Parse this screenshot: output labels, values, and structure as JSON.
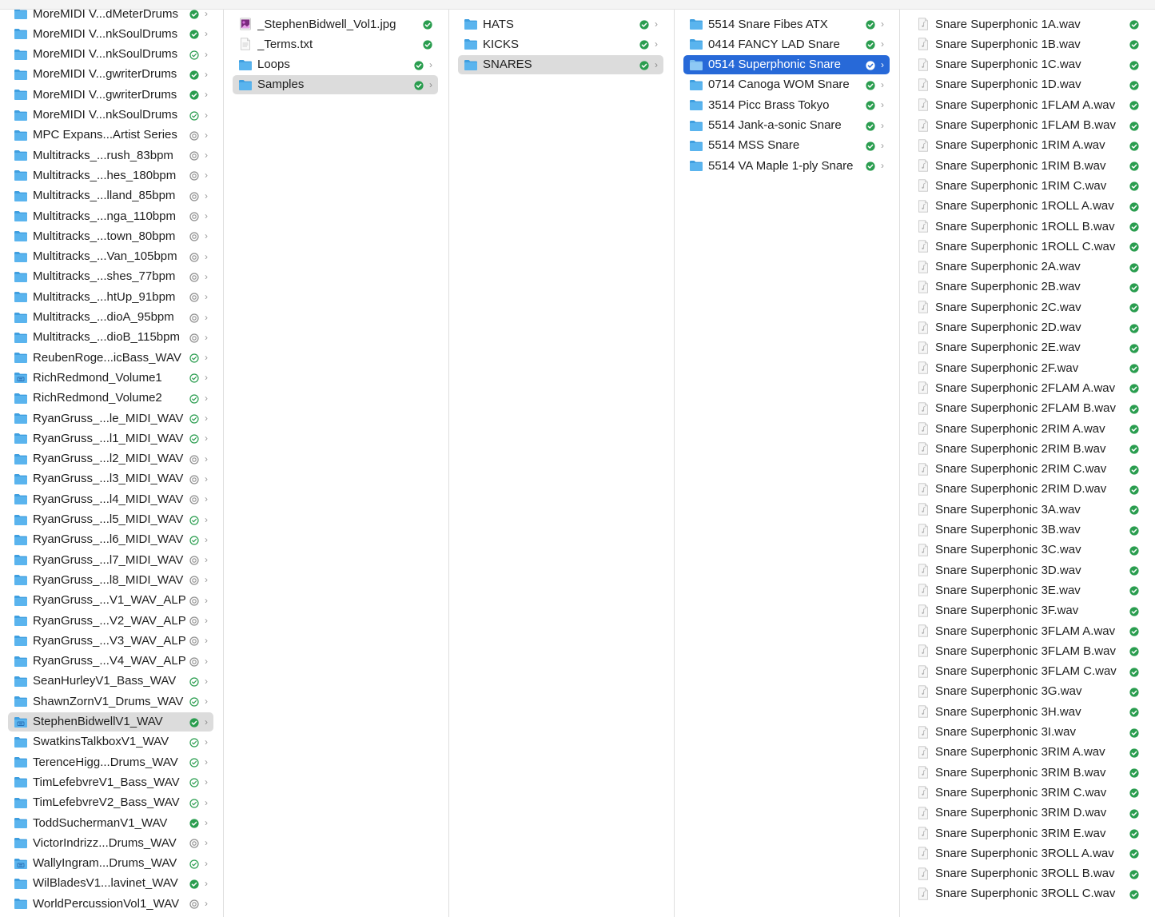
{
  "columns": [
    {
      "name": "library",
      "items": [
        {
          "label": "MoreMIDI V...dMeterDrums",
          "icon": "folder-icon",
          "status": "synced"
        },
        {
          "label": "MoreMIDI V...nkSoulDrums",
          "icon": "folder-icon",
          "status": "synced"
        },
        {
          "label": "MoreMIDI V...nkSoulDrums",
          "icon": "folder-icon",
          "status": "available"
        },
        {
          "label": "MoreMIDI V...gwriterDrums",
          "icon": "folder-icon",
          "status": "synced"
        },
        {
          "label": "MoreMIDI V...gwriterDrums",
          "icon": "folder-icon",
          "status": "synced"
        },
        {
          "label": "MoreMIDI V...nkSoulDrums",
          "icon": "folder-icon",
          "status": "available"
        },
        {
          "label": "MPC Expans...Artist Series",
          "icon": "folder-icon",
          "status": "cloud"
        },
        {
          "label": "Multitracks_...rush_83bpm",
          "icon": "folder-icon",
          "status": "cloud"
        },
        {
          "label": "Multitracks_...hes_180bpm",
          "icon": "folder-icon",
          "status": "cloud"
        },
        {
          "label": "Multitracks_...lland_85bpm",
          "icon": "folder-icon",
          "status": "cloud"
        },
        {
          "label": "Multitracks_...nga_110bpm",
          "icon": "folder-icon",
          "status": "cloud"
        },
        {
          "label": "Multitracks_...town_80bpm",
          "icon": "folder-icon",
          "status": "cloud"
        },
        {
          "label": "Multitracks_...Van_105bpm",
          "icon": "folder-icon",
          "status": "cloud"
        },
        {
          "label": "Multitracks_...shes_77bpm",
          "icon": "folder-icon",
          "status": "cloud"
        },
        {
          "label": "Multitracks_...htUp_91bpm",
          "icon": "folder-icon",
          "status": "cloud"
        },
        {
          "label": "Multitracks_...dioA_95bpm",
          "icon": "folder-icon",
          "status": "cloud"
        },
        {
          "label": "Multitracks_...dioB_115bpm",
          "icon": "folder-icon",
          "status": "cloud"
        },
        {
          "label": "ReubenRoge...icBass_WAV",
          "icon": "folder-icon",
          "status": "available"
        },
        {
          "label": "RichRedmond_Volume1",
          "icon": "app-folder-icon",
          "status": "available"
        },
        {
          "label": "RichRedmond_Volume2",
          "icon": "folder-icon",
          "status": "available"
        },
        {
          "label": "RyanGruss_...le_MIDI_WAV",
          "icon": "folder-icon",
          "status": "available"
        },
        {
          "label": "RyanGruss_...l1_MIDI_WAV",
          "icon": "folder-icon",
          "status": "available"
        },
        {
          "label": "RyanGruss_...l2_MIDI_WAV",
          "icon": "folder-icon",
          "status": "cloud"
        },
        {
          "label": "RyanGruss_...l3_MIDI_WAV",
          "icon": "folder-icon",
          "status": "cloud"
        },
        {
          "label": "RyanGruss_...l4_MIDI_WAV",
          "icon": "folder-icon",
          "status": "cloud"
        },
        {
          "label": "RyanGruss_...l5_MIDI_WAV",
          "icon": "folder-icon",
          "status": "available"
        },
        {
          "label": "RyanGruss_...l6_MIDI_WAV",
          "icon": "folder-icon",
          "status": "available"
        },
        {
          "label": "RyanGruss_...l7_MIDI_WAV",
          "icon": "folder-icon",
          "status": "cloud"
        },
        {
          "label": "RyanGruss_...l8_MIDI_WAV",
          "icon": "folder-icon",
          "status": "cloud"
        },
        {
          "label": "RyanGruss_...V1_WAV_ALP",
          "icon": "folder-icon",
          "status": "cloud"
        },
        {
          "label": "RyanGruss_...V2_WAV_ALP",
          "icon": "folder-icon",
          "status": "cloud"
        },
        {
          "label": "RyanGruss_...V3_WAV_ALP",
          "icon": "folder-icon",
          "status": "cloud"
        },
        {
          "label": "RyanGruss_...V4_WAV_ALP",
          "icon": "folder-icon",
          "status": "cloud"
        },
        {
          "label": "SeanHurleyV1_Bass_WAV",
          "icon": "folder-icon",
          "status": "available"
        },
        {
          "label": "ShawnZornV1_Drums_WAV",
          "icon": "folder-icon",
          "status": "available"
        },
        {
          "label": "StephenBidwellV1_WAV",
          "icon": "app-folder-icon",
          "status": "synced",
          "selected": "gray",
          "chevron": true
        },
        {
          "label": "SwatkinsTalkboxV1_WAV",
          "icon": "folder-icon",
          "status": "available"
        },
        {
          "label": "TerenceHigg...Drums_WAV",
          "icon": "folder-icon",
          "status": "available"
        },
        {
          "label": "TimLefebvreV1_Bass_WAV",
          "icon": "folder-icon",
          "status": "available"
        },
        {
          "label": "TimLefebvreV2_Bass_WAV",
          "icon": "folder-icon",
          "status": "available"
        },
        {
          "label": "ToddSuchermanV1_WAV",
          "icon": "folder-icon",
          "status": "synced"
        },
        {
          "label": "VictorIndrizz...Drums_WAV",
          "icon": "folder-icon",
          "status": "cloud"
        },
        {
          "label": "WallyIngram...Drums_WAV",
          "icon": "app-folder-icon",
          "status": "available"
        },
        {
          "label": "WilBladesV1...lavinet_WAV",
          "icon": "folder-icon",
          "status": "synced"
        },
        {
          "label": "WorldPercussionVol1_WAV",
          "icon": "folder-icon",
          "status": "cloud"
        }
      ]
    },
    {
      "name": "stephen-bidwell",
      "items": [
        {
          "label": "_StephenBidwell_Vol1.jpg",
          "icon": "image-file-icon",
          "status": "synced",
          "chevron": false
        },
        {
          "label": "_Terms.txt",
          "icon": "text-file-icon",
          "status": "synced",
          "chevron": false
        },
        {
          "label": "Loops",
          "icon": "folder-icon",
          "status": "synced"
        },
        {
          "label": "Samples",
          "icon": "folder-icon",
          "status": "synced",
          "selected": "gray"
        }
      ]
    },
    {
      "name": "samples",
      "items": [
        {
          "label": "HATS",
          "icon": "folder-icon",
          "status": "synced"
        },
        {
          "label": "KICKS",
          "icon": "folder-icon",
          "status": "synced"
        },
        {
          "label": "SNARES",
          "icon": "folder-icon",
          "status": "synced",
          "selected": "gray"
        }
      ]
    },
    {
      "name": "snares",
      "items": [
        {
          "label": " 5514 Snare Fibes ATX",
          "icon": "folder-icon",
          "status": "synced"
        },
        {
          "label": "0414 FANCY LAD Snare",
          "icon": "folder-icon",
          "status": "synced"
        },
        {
          "label": "0514 Superphonic Snare",
          "icon": "folder-icon",
          "status": "synced",
          "selected": "blue"
        },
        {
          "label": "0714 Canoga WOM Snare",
          "icon": "folder-icon",
          "status": "synced"
        },
        {
          "label": "3514 Picc Brass Tokyo",
          "icon": "folder-icon",
          "status": "synced"
        },
        {
          "label": "5514 Jank-a-sonic Snare",
          "icon": "folder-icon",
          "status": "synced"
        },
        {
          "label": "5514 MSS Snare",
          "icon": "folder-icon",
          "status": "synced"
        },
        {
          "label": "5514 VA Maple 1-ply Snare",
          "icon": "folder-icon",
          "status": "synced"
        }
      ]
    },
    {
      "name": "superphonic-snare",
      "items": [
        {
          "label": "Snare Superphonic 1A.wav",
          "icon": "audio-file-icon",
          "status": "synced",
          "chevron": false
        },
        {
          "label": "Snare Superphonic 1B.wav",
          "icon": "audio-file-icon",
          "status": "synced",
          "chevron": false
        },
        {
          "label": "Snare Superphonic 1C.wav",
          "icon": "audio-file-icon",
          "status": "synced",
          "chevron": false
        },
        {
          "label": "Snare Superphonic 1D.wav",
          "icon": "audio-file-icon",
          "status": "synced",
          "chevron": false
        },
        {
          "label": "Snare Superphonic 1FLAM A.wav",
          "icon": "audio-file-icon",
          "status": "synced",
          "chevron": false
        },
        {
          "label": "Snare Superphonic 1FLAM B.wav",
          "icon": "audio-file-icon",
          "status": "synced",
          "chevron": false
        },
        {
          "label": "Snare Superphonic 1RIM A.wav",
          "icon": "audio-file-icon",
          "status": "synced",
          "chevron": false
        },
        {
          "label": "Snare Superphonic 1RIM B.wav",
          "icon": "audio-file-icon",
          "status": "synced",
          "chevron": false
        },
        {
          "label": "Snare Superphonic 1RIM C.wav",
          "icon": "audio-file-icon",
          "status": "synced",
          "chevron": false
        },
        {
          "label": "Snare Superphonic 1ROLL A.wav",
          "icon": "audio-file-icon",
          "status": "synced",
          "chevron": false
        },
        {
          "label": "Snare Superphonic 1ROLL B.wav",
          "icon": "audio-file-icon",
          "status": "synced",
          "chevron": false
        },
        {
          "label": "Snare Superphonic 1ROLL C.wav",
          "icon": "audio-file-icon",
          "status": "synced",
          "chevron": false
        },
        {
          "label": "Snare Superphonic 2A.wav",
          "icon": "audio-file-icon",
          "status": "synced",
          "chevron": false
        },
        {
          "label": "Snare Superphonic 2B.wav",
          "icon": "audio-file-icon",
          "status": "synced",
          "chevron": false
        },
        {
          "label": "Snare Superphonic 2C.wav",
          "icon": "audio-file-icon",
          "status": "synced",
          "chevron": false
        },
        {
          "label": "Snare Superphonic 2D.wav",
          "icon": "audio-file-icon",
          "status": "synced",
          "chevron": false
        },
        {
          "label": "Snare Superphonic 2E.wav",
          "icon": "audio-file-icon",
          "status": "synced",
          "chevron": false
        },
        {
          "label": "Snare Superphonic 2F.wav",
          "icon": "audio-file-icon",
          "status": "synced",
          "chevron": false
        },
        {
          "label": "Snare Superphonic 2FLAM A.wav",
          "icon": "audio-file-icon",
          "status": "synced",
          "chevron": false
        },
        {
          "label": "Snare Superphonic 2FLAM B.wav",
          "icon": "audio-file-icon",
          "status": "synced",
          "chevron": false
        },
        {
          "label": "Snare Superphonic 2RIM A.wav",
          "icon": "audio-file-icon",
          "status": "synced",
          "chevron": false
        },
        {
          "label": "Snare Superphonic 2RIM B.wav",
          "icon": "audio-file-icon",
          "status": "synced",
          "chevron": false
        },
        {
          "label": "Snare Superphonic 2RIM C.wav",
          "icon": "audio-file-icon",
          "status": "synced",
          "chevron": false
        },
        {
          "label": "Snare Superphonic 2RIM D.wav",
          "icon": "audio-file-icon",
          "status": "synced",
          "chevron": false
        },
        {
          "label": "Snare Superphonic 3A.wav",
          "icon": "audio-file-icon",
          "status": "synced",
          "chevron": false
        },
        {
          "label": "Snare Superphonic 3B.wav",
          "icon": "audio-file-icon",
          "status": "synced",
          "chevron": false
        },
        {
          "label": "Snare Superphonic 3C.wav",
          "icon": "audio-file-icon",
          "status": "synced",
          "chevron": false
        },
        {
          "label": "Snare Superphonic 3D.wav",
          "icon": "audio-file-icon",
          "status": "synced",
          "chevron": false
        },
        {
          "label": "Snare Superphonic 3E.wav",
          "icon": "audio-file-icon",
          "status": "synced",
          "chevron": false
        },
        {
          "label": "Snare Superphonic 3F.wav",
          "icon": "audio-file-icon",
          "status": "synced",
          "chevron": false
        },
        {
          "label": "Snare Superphonic 3FLAM A.wav",
          "icon": "audio-file-icon",
          "status": "synced",
          "chevron": false
        },
        {
          "label": "Snare Superphonic 3FLAM B.wav",
          "icon": "audio-file-icon",
          "status": "synced",
          "chevron": false
        },
        {
          "label": "Snare Superphonic 3FLAM C.wav",
          "icon": "audio-file-icon",
          "status": "synced",
          "chevron": false
        },
        {
          "label": "Snare Superphonic 3G.wav",
          "icon": "audio-file-icon",
          "status": "synced",
          "chevron": false
        },
        {
          "label": "Snare Superphonic 3H.wav",
          "icon": "audio-file-icon",
          "status": "synced",
          "chevron": false
        },
        {
          "label": "Snare Superphonic 3I.wav",
          "icon": "audio-file-icon",
          "status": "synced",
          "chevron": false
        },
        {
          "label": "Snare Superphonic 3RIM A.wav",
          "icon": "audio-file-icon",
          "status": "synced",
          "chevron": false
        },
        {
          "label": "Snare Superphonic 3RIM B.wav",
          "icon": "audio-file-icon",
          "status": "synced",
          "chevron": false
        },
        {
          "label": "Snare Superphonic 3RIM C.wav",
          "icon": "audio-file-icon",
          "status": "synced",
          "chevron": false
        },
        {
          "label": "Snare Superphonic 3RIM D.wav",
          "icon": "audio-file-icon",
          "status": "synced",
          "chevron": false
        },
        {
          "label": "Snare Superphonic 3RIM E.wav",
          "icon": "audio-file-icon",
          "status": "synced",
          "chevron": false
        },
        {
          "label": "Snare Superphonic 3ROLL A.wav",
          "icon": "audio-file-icon",
          "status": "synced",
          "chevron": false
        },
        {
          "label": "Snare Superphonic 3ROLL B.wav",
          "icon": "audio-file-icon",
          "status": "synced",
          "chevron": false
        },
        {
          "label": "Snare Superphonic 3ROLL C.wav",
          "icon": "audio-file-icon",
          "status": "synced",
          "chevron": false
        }
      ]
    }
  ],
  "colors": {
    "folder": "#5ab4ee",
    "folder_tab": "#3f9fe0",
    "synced": "#2a9d4f",
    "selection_blue": "#2769d8",
    "selection_gray": "#dcdcdc",
    "cloud_icon": "#8e8e8e"
  }
}
